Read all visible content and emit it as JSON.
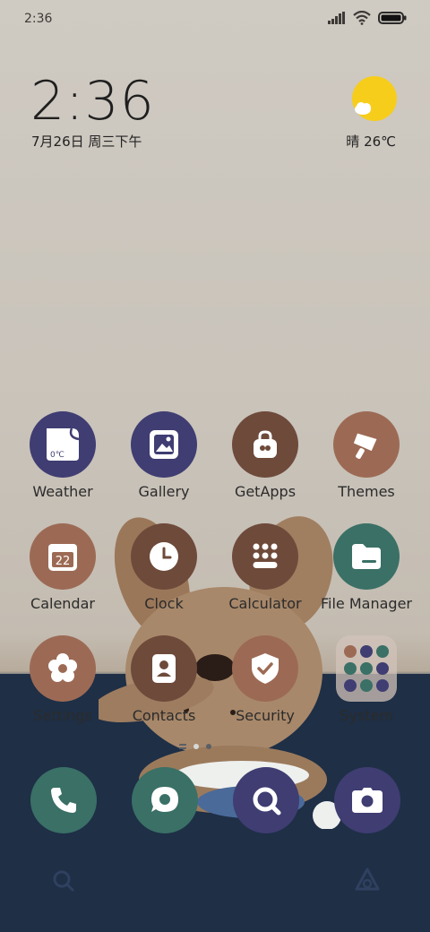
{
  "status": {
    "time": "2:36"
  },
  "clock": {
    "time": "2:36",
    "date": "7月26日 周三下午"
  },
  "weather": {
    "text": "晴 26℃",
    "icon": "sun-cloud-icon"
  },
  "apps": [
    {
      "label": "Weather",
      "color": "#3f3d72",
      "icon": "weather-icon"
    },
    {
      "label": "Gallery",
      "color": "#3f3d72",
      "icon": "gallery-icon"
    },
    {
      "label": "GetApps",
      "color": "#6e4a3b",
      "icon": "bag-icon"
    },
    {
      "label": "Themes",
      "color": "#9c6a54",
      "icon": "brush-icon"
    },
    {
      "label": "Calendar",
      "color": "#9c6a54",
      "icon": "calendar-icon",
      "date": "22"
    },
    {
      "label": "Clock",
      "color": "#6e4a3b",
      "icon": "clock-icon"
    },
    {
      "label": "Calculator",
      "color": "#6e4a3b",
      "icon": "calculator-icon"
    },
    {
      "label": "File Manager",
      "color": "#3a7066",
      "icon": "folder-icon"
    },
    {
      "label": "Settings",
      "color": "#9c6a54",
      "icon": "settings-icon"
    },
    {
      "label": "Contacts",
      "color": "#6e4a3b",
      "icon": "contacts-icon"
    },
    {
      "label": "Security",
      "color": "#9c6a54",
      "icon": "shield-icon"
    },
    {
      "label": "System",
      "color": "#c9b8ad",
      "icon": "folder-grid-icon"
    }
  ],
  "weather_icon_temp": "0℃",
  "dock": [
    {
      "name": "phone",
      "color": "#3a7066",
      "icon": "phone-icon"
    },
    {
      "name": "messages",
      "color": "#3a7066",
      "icon": "message-icon"
    },
    {
      "name": "browser",
      "color": "#3f3d72",
      "icon": "search-icon"
    },
    {
      "name": "camera",
      "color": "#3f3d72",
      "icon": "camera-icon"
    }
  ]
}
